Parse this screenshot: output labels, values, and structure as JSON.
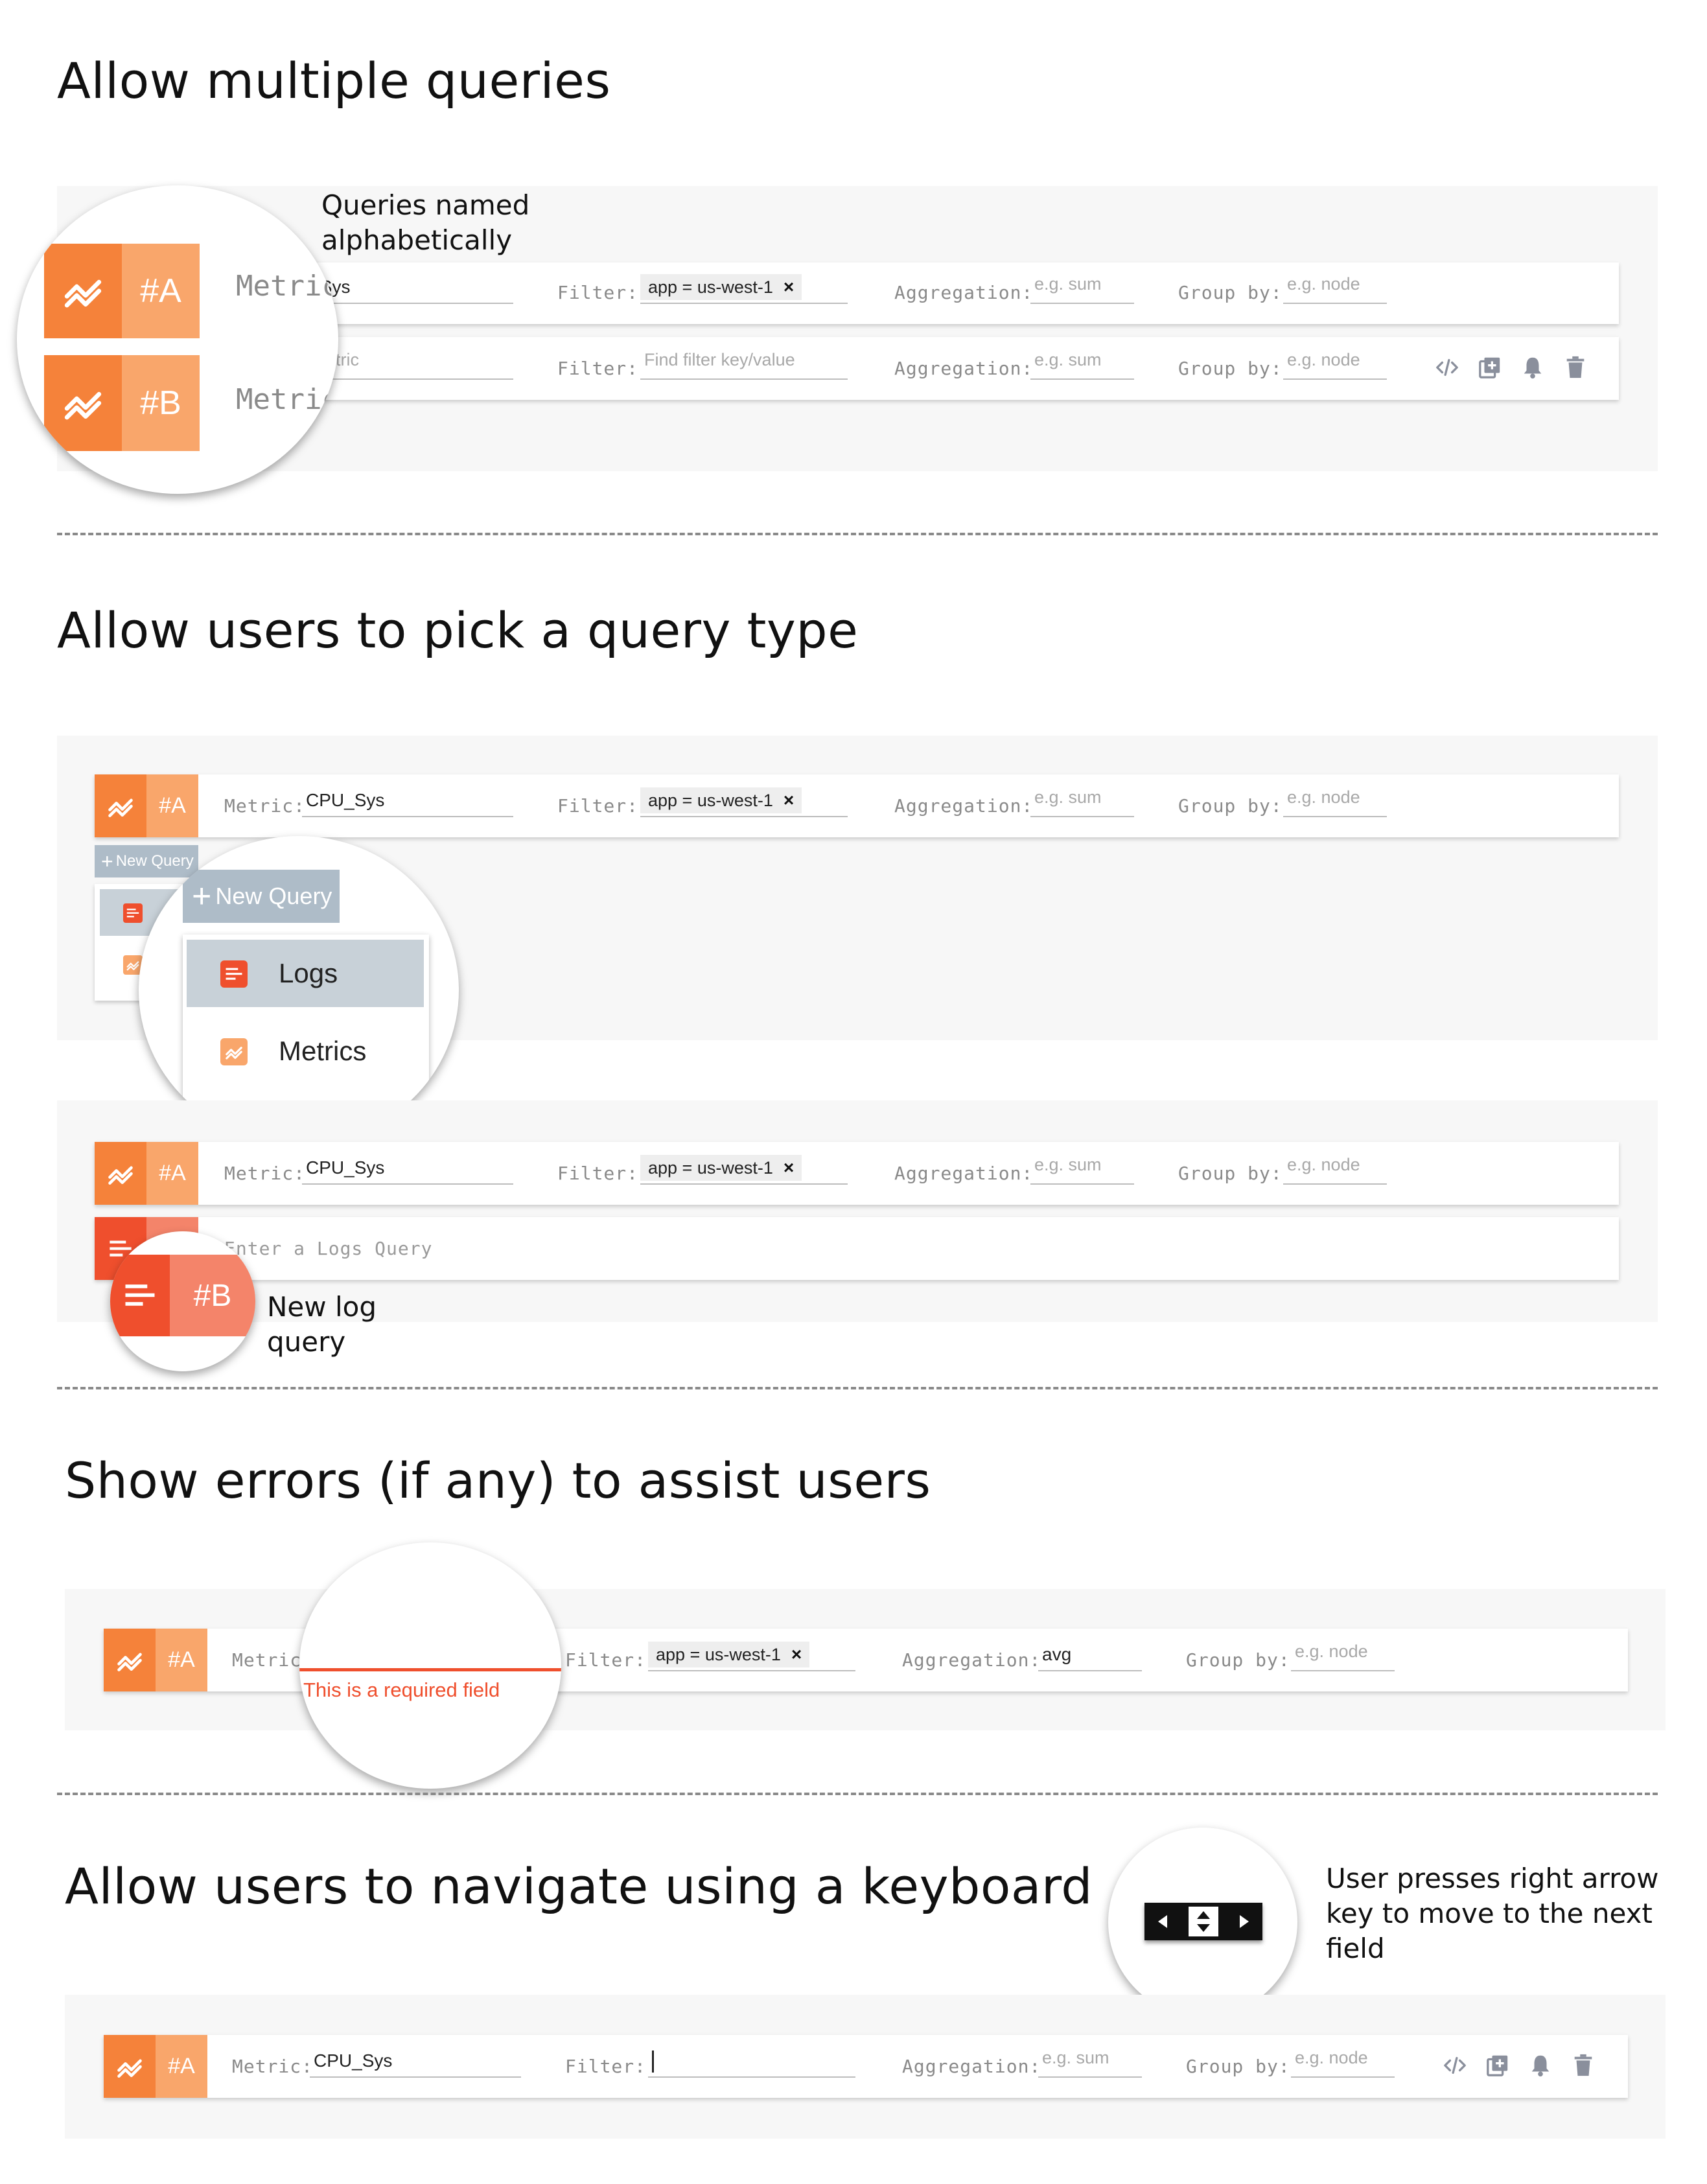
{
  "sections": {
    "s1": {
      "title": "Allow multiple queries",
      "note": [
        "Queries named",
        "alphabetically"
      ]
    },
    "s2": {
      "title": "Allow users to pick a query type",
      "note": [
        "New log",
        "query"
      ]
    },
    "s3": {
      "title": "Show errors (if any) to assist users"
    },
    "s4": {
      "title": "Allow users to navigate using a keyboard",
      "note": [
        "User presses right arrow",
        "key to move to the next",
        "field"
      ]
    }
  },
  "labels": {
    "metric": "Metric:",
    "metric_zoom": "Metric",
    "filter": "Filter:",
    "aggregation": "Aggregation:",
    "group_by": "Group by:"
  },
  "queries": {
    "a_letter": "#A",
    "b_letter": "#B",
    "metric_value": "CPU_Sys",
    "metric_value_cut": "U_Sys",
    "metric_placeholder_cut": "d metric",
    "filter_chip": "app = us-west-1",
    "chip_close": "×",
    "filter_placeholder": "Find filter key/value",
    "aggregation_placeholder": "e.g. sum",
    "aggregation_value": "avg",
    "group_placeholder": "e.g. node",
    "logs_placeholder": "Enter a Logs Query",
    "error_text": "This is a required field"
  },
  "new_query": {
    "label": "New Query",
    "plus": "+",
    "options": [
      "Logs",
      "Metrics"
    ]
  },
  "colors": {
    "metric_dark": "#f5823a",
    "metric_light": "#f9a66b",
    "log_dark": "#ef4f2d",
    "log_light": "#f4846a",
    "error": "#ef4f2d",
    "button_grey": "#aebcc8",
    "selected_option": "#c8d1d8"
  },
  "icons": [
    "metrics-chart-icon",
    "logs-list-icon",
    "code-icon",
    "duplicate-icon",
    "bell-icon",
    "trash-icon",
    "arrow-left-icon",
    "arrow-up-down-icon",
    "arrow-right-icon"
  ]
}
